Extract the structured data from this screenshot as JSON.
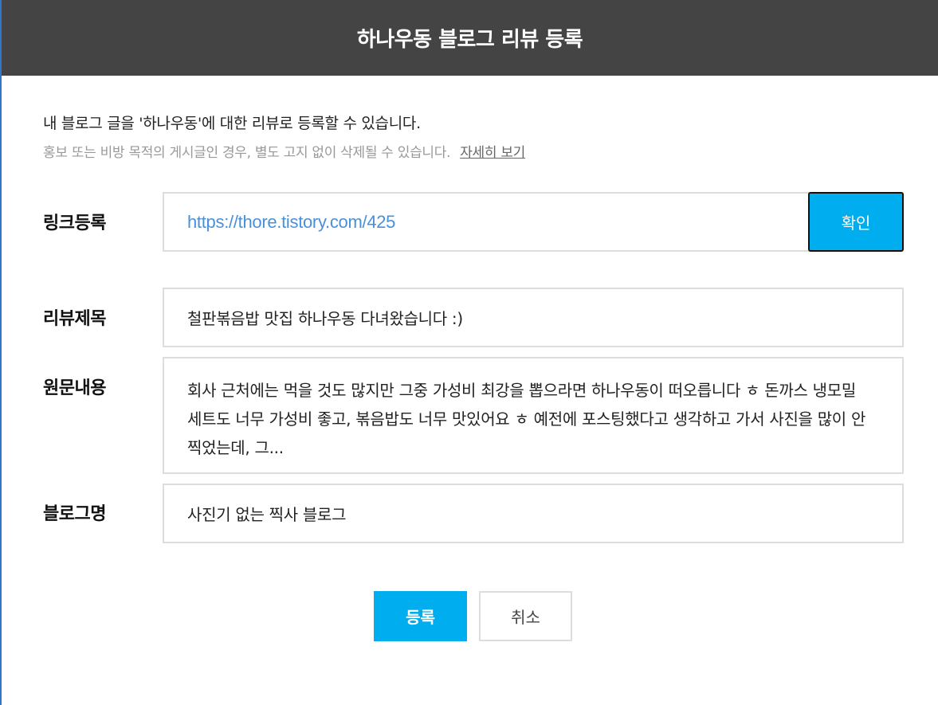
{
  "header": {
    "title": "하나우동 블로그 리뷰 등록"
  },
  "intro": {
    "text": "내 블로그 글을 '하나우동'에 대한 리뷰로 등록할 수 있습니다.",
    "notice": "홍보 또는 비방 목적의 게시글인 경우, 별도 고지 없이 삭제될 수 있습니다.",
    "notice_link": "자세히 보기"
  },
  "form": {
    "link": {
      "label": "링크등록",
      "value": "https://thore.tistory.com/425",
      "confirm_label": "확인"
    },
    "title": {
      "label": "리뷰제목",
      "value": "철판볶음밥 맛집 하나우동 다녀왔습니다 :)"
    },
    "content": {
      "label": "원문내용",
      "value": "회사 근처에는 먹을 것도 많지만 그중 가성비 최강을 뽑으라면 하나우동이 떠오릅니다 ㅎ 돈까스 냉모밀 세트도 너무 가성비 좋고, 볶음밥도 너무 맛있어요 ㅎ 예전에 포스팅했다고 생각하고 가서 사진을 많이 안찍었는데, 그..."
    },
    "blog": {
      "label": "블로그명",
      "value": "사진기 없는 찍사 블로그"
    }
  },
  "actions": {
    "submit_label": "등록",
    "cancel_label": "취소"
  },
  "colors": {
    "header_bg": "#444444",
    "accent": "#00aeef",
    "link_text": "#4a90d9",
    "border": "#dddddd"
  }
}
